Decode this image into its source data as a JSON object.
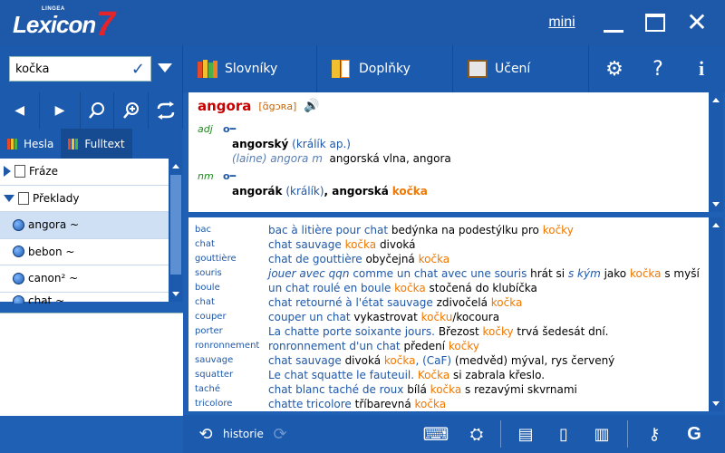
{
  "app": {
    "brand_top": "LINGEA",
    "brand_name": "Lexicon",
    "brand_version": "7"
  },
  "window": {
    "mini_label": "mini"
  },
  "search": {
    "value": "kočka"
  },
  "left_tabs": [
    {
      "label": "Hesla"
    },
    {
      "label": "Fulltext"
    }
  ],
  "tree": [
    {
      "label": "Fráze",
      "type": "folder",
      "expanded": false
    },
    {
      "label": "Překlady",
      "type": "folder",
      "expanded": true
    },
    {
      "label": "angora ~",
      "type": "item",
      "selected": true
    },
    {
      "label": "bebon ~",
      "type": "item",
      "selected": false
    },
    {
      "label": "canon² ~",
      "type": "item",
      "selected": false
    },
    {
      "label": "chat ~",
      "type": "item",
      "selected": false
    }
  ],
  "toolbar": {
    "tabs": [
      {
        "label": "Slovníky"
      },
      {
        "label": "Doplňky"
      },
      {
        "label": "Učení"
      }
    ],
    "help": "?",
    "info": "i"
  },
  "entry": {
    "headword": "angora",
    "pronunciation": "[ɑ̃gɔʀa]",
    "senses": [
      {
        "pos": "adj",
        "word": "angorský",
        "gloss": "(králík ap.)",
        "example_fr": "(laine) angora m",
        "example_cz": "angorská vlna, angora"
      },
      {
        "pos": "nm",
        "word": "angorák",
        "gloss": "(králík)",
        "rest": ", angorská",
        "highlight": "kočka"
      }
    ]
  },
  "fulltext": [
    {
      "key": "bac",
      "parts": [
        [
          "fr",
          "bac  à litière pour chat"
        ],
        [
          "cz",
          " bedýnka na podestýlku pro "
        ],
        [
          "or",
          "kočky"
        ]
      ]
    },
    {
      "key": "chat",
      "parts": [
        [
          "fr",
          "chat sauvage "
        ],
        [
          "or",
          " kočka"
        ],
        [
          "cz",
          " divoká"
        ]
      ]
    },
    {
      "key": "gouttière",
      "parts": [
        [
          "fr",
          "chat de gouttière "
        ],
        [
          "cz",
          " obyčejná "
        ],
        [
          "or",
          "kočka"
        ]
      ]
    },
    {
      "key": "souris",
      "parts": [
        [
          "it",
          "jouer avec qqn"
        ],
        [
          "fr",
          " comme un chat avec une souris "
        ],
        [
          "cz",
          " hrát si "
        ],
        [
          "it",
          "s kým"
        ],
        [
          "cz",
          " jako "
        ],
        [
          "or",
          "kočka"
        ],
        [
          "cz",
          " s myší"
        ]
      ]
    },
    {
      "key": "boule",
      "parts": [
        [
          "fr",
          "un chat roulé en boule "
        ],
        [
          "or",
          " kočka"
        ],
        [
          "cz",
          " stočená do klubíčka"
        ]
      ]
    },
    {
      "key": "chat",
      "parts": [
        [
          "fr",
          "chat retourné à l'état sauvage "
        ],
        [
          "cz",
          " zdivočelá "
        ],
        [
          "or",
          "kočka"
        ]
      ]
    },
    {
      "key": "couper",
      "parts": [
        [
          "fr",
          "couper un chat "
        ],
        [
          "cz",
          " vykastrovat "
        ],
        [
          "or",
          "kočku"
        ],
        [
          "cz",
          "/kocoura"
        ]
      ]
    },
    {
      "key": "porter",
      "parts": [
        [
          "fr",
          "La chatte porte soixante jours. "
        ],
        [
          "cz",
          " Březost "
        ],
        [
          "or",
          "kočky"
        ],
        [
          "cz",
          " trvá šedesát dní."
        ]
      ]
    },
    {
      "key": "ronronnement",
      "parts": [
        [
          "fr",
          "ronronnement d'un chat "
        ],
        [
          "cz",
          " předení "
        ],
        [
          "or",
          "kočky"
        ]
      ]
    },
    {
      "key": "sauvage",
      "parts": [
        [
          "fr",
          "chat sauvage "
        ],
        [
          "cz",
          " divoká "
        ],
        [
          "or",
          "kočka"
        ],
        [
          "fr",
          ", (CaF)"
        ],
        [
          "cz",
          " (medvěd) mýval, rys červený"
        ]
      ]
    },
    {
      "key": "squatter",
      "parts": [
        [
          "fr",
          "Le chat squatte le fauteuil. "
        ],
        [
          "or",
          " Kočka"
        ],
        [
          "cz",
          " si zabrala křeslo."
        ]
      ]
    },
    {
      "key": "taché",
      "parts": [
        [
          "fr",
          "chat blanc taché de roux "
        ],
        [
          "cz",
          " bílá "
        ],
        [
          "or",
          "kočka"
        ],
        [
          "cz",
          " s rezavými skvrnami"
        ]
      ]
    },
    {
      "key": "tricolore",
      "parts": [
        [
          "fr",
          "chatte tricolore "
        ],
        [
          "cz",
          " tříbarevná "
        ],
        [
          "or",
          "kočka"
        ]
      ]
    }
  ],
  "bottombar": {
    "history_label": "historie"
  },
  "colors": {
    "accent": "#1c5aad",
    "headword": "#c80000",
    "highlight": "#f07800",
    "pos": "#1a8c1a"
  }
}
